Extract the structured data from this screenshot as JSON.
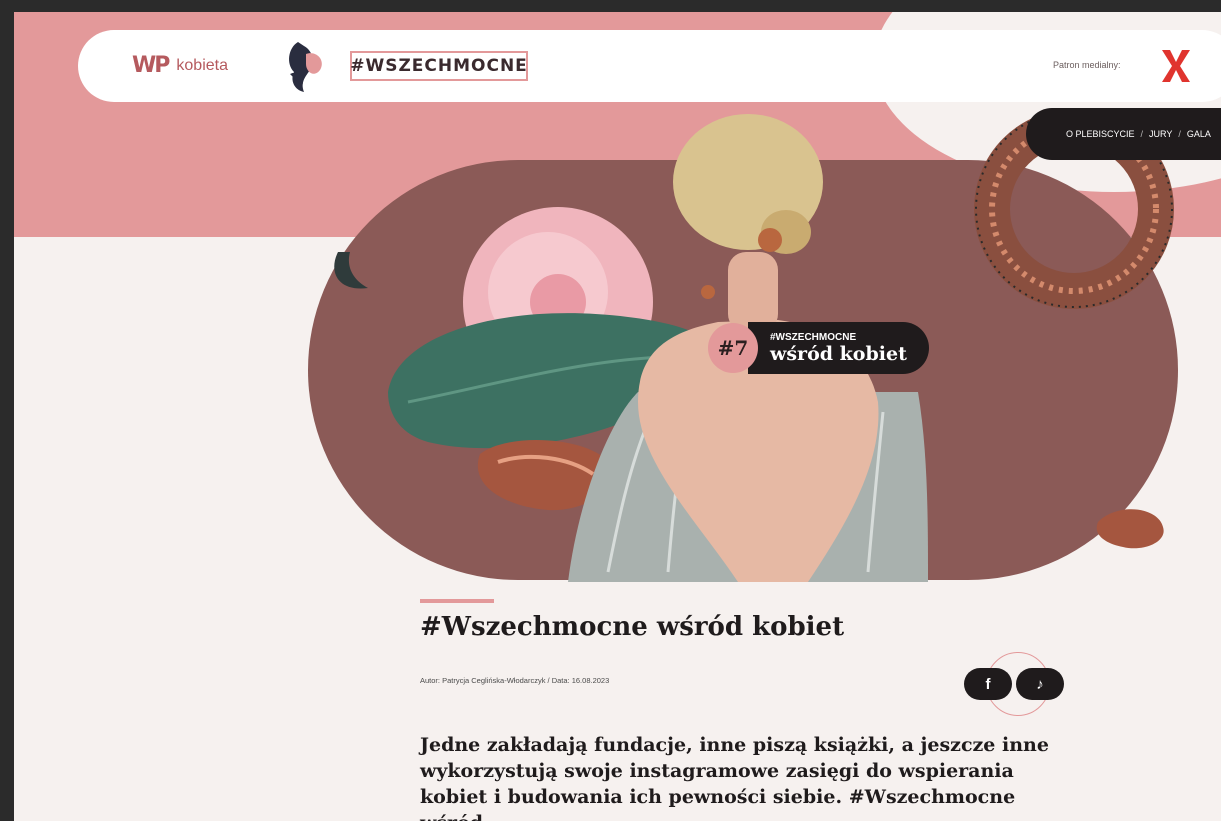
{
  "header": {
    "logo_mark": "WP",
    "logo_text": "kobieta",
    "hashtag": "#WSZECHMOCNE",
    "patron_label": "Patron medialny:"
  },
  "nav": {
    "items": [
      "O PLEBISCYCIE",
      "JURY",
      "GALA"
    ],
    "separator": "/"
  },
  "hero": {
    "badge_number": "#7",
    "badge_tag": "#WSZECHMOCNE",
    "badge_title": "wśród kobiet"
  },
  "article": {
    "title": "#Wszechmocne wśród kobiet",
    "meta": "Autor: Patrycja Ceglińska-Włodarczyk / Data: 16.08.2023",
    "lead": "Jedne zakładają fundacje, inne piszą książki, a jeszcze inne wykorzystują swoje instagramowe zasięgi do wspierania kobiet i budowania ich pewności siebie. #Wszechmocne wśród"
  },
  "social": {
    "facebook_glyph": "f",
    "tiktok_glyph": "♪"
  },
  "colors": {
    "accent": "#e3999a",
    "brand": "#b55a5e",
    "dark": "#1f1b1c",
    "hero_bg": "#8b5a57"
  }
}
